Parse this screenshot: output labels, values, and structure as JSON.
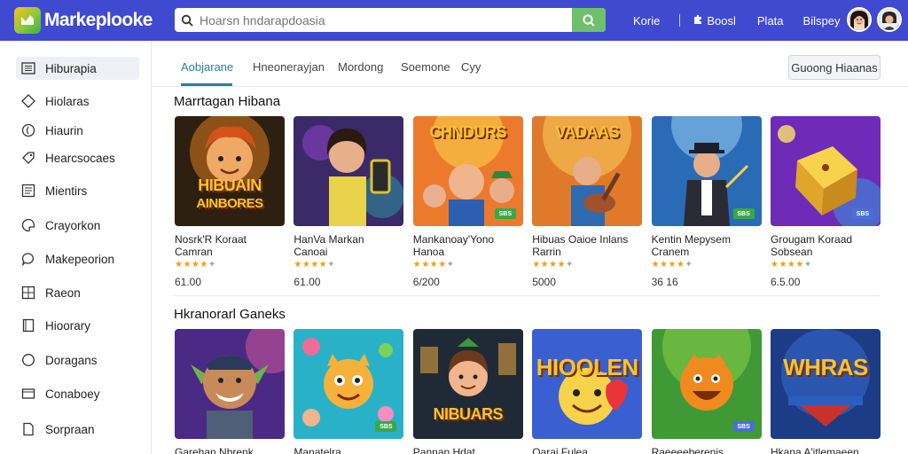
{
  "app": {
    "title": "Markeplooke",
    "search_placeholder": "Hoarsn hndarapdoasia",
    "top_links": [
      "Korie",
      "Boosl",
      "Plata",
      "Bilspey"
    ]
  },
  "sidebar": {
    "items": [
      {
        "label": "Hiburapia",
        "icon": "grid-list-icon",
        "active": true
      },
      {
        "label": "Hiolaras",
        "icon": "diamond-icon",
        "active": false
      },
      {
        "label": "Hiaurin",
        "icon": "swirl-icon",
        "active": false
      },
      {
        "label": "Hearcsocaes",
        "icon": "tag-icon",
        "active": false
      },
      {
        "label": "Mientirs",
        "icon": "list-icon",
        "active": false
      },
      {
        "label": "Crayorkon",
        "icon": "palette-icon",
        "active": false
      },
      {
        "label": "Makepeorion",
        "icon": "chat-icon",
        "active": false
      },
      {
        "label": "Raeon",
        "icon": "grid-icon",
        "active": false
      },
      {
        "label": "Hioorary",
        "icon": "book-icon",
        "active": false
      },
      {
        "label": "Doragans",
        "icon": "circle-icon",
        "active": false
      },
      {
        "label": "Conaboey",
        "icon": "card-icon",
        "active": false
      },
      {
        "label": "Sorpraan",
        "icon": "doc-icon",
        "active": false
      }
    ]
  },
  "tabs": {
    "items": [
      "Aobjarane",
      "Hneonerayjan",
      "Mordong",
      "Soemone",
      "Cyy"
    ],
    "active": 0,
    "action_label": "Guoong Hiaanas"
  },
  "sections": [
    {
      "title": "Marrtagan Hibana",
      "items": [
        {
          "title": "Nosrk'R Koraat",
          "subtitle": "Camran",
          "rating": 4,
          "price": "61.00",
          "art": "hero",
          "art_text_1": "HIBUAIN",
          "art_text_2": "AINBORES",
          "badge": ""
        },
        {
          "title": "HanVa Markan",
          "subtitle": "Canoai",
          "rating": 4,
          "price": "61.00",
          "art": "girl",
          "art_text_1": "",
          "art_text_2": "",
          "badge": ""
        },
        {
          "title": "Mankanoay'Yono",
          "subtitle": "Hanoa",
          "rating": 4,
          "price": "6/200",
          "art": "kids",
          "art_text_1": "CHNDURS",
          "art_text_2": "",
          "badge": "SBS"
        },
        {
          "title": "Hibuas Oaioe Inlans",
          "subtitle": "Rarrin",
          "rating": 4,
          "price": "5000",
          "art": "guitar",
          "art_text_1": "VADAAS",
          "art_text_2": "",
          "badge": ""
        },
        {
          "title": "Kentin Mepysem",
          "subtitle": "Cranem",
          "rating": 4,
          "price": "36 16",
          "art": "magician",
          "art_text_1": "",
          "art_text_2": "",
          "badge": "SBS"
        },
        {
          "title": "Grougam Koraad",
          "subtitle": "Sobsean",
          "rating": 4,
          "price": "6.5.00",
          "art": "dice",
          "art_text_1": "",
          "art_text_2": "",
          "badge": "SBS"
        }
      ]
    },
    {
      "title": "Hkranorarl Ganeks",
      "items": [
        {
          "title": "Garehan Nbrenk",
          "art": "goblin",
          "art_text_1": "",
          "art_text_2": "",
          "badge": ""
        },
        {
          "title": "Manatelra",
          "art": "cartoon",
          "art_text_1": "",
          "art_text_2": "",
          "badge": "SBS"
        },
        {
          "title": "Pannan Hdat",
          "art": "boy",
          "art_text_1": "NIBUARS",
          "art_text_2": "",
          "badge": ""
        },
        {
          "title": "Oarai Fulea",
          "art": "emoji",
          "art_text_1": "HIOOLEN",
          "art_text_2": "",
          "badge": ""
        },
        {
          "title": "Raeeeeberenis",
          "art": "smiley",
          "art_text_1": "",
          "art_text_2": "",
          "badge": "SBS"
        },
        {
          "title": "Hkana A'itlemaeen",
          "art": "logo",
          "art_text_1": "WHRAS",
          "art_text_2": "",
          "badge": ""
        }
      ]
    }
  ],
  "colors": {
    "topbar": "#3f4ad1",
    "accent": "#2a7f9e",
    "search_button": "#6fc06b",
    "star": "#f59e0b"
  }
}
